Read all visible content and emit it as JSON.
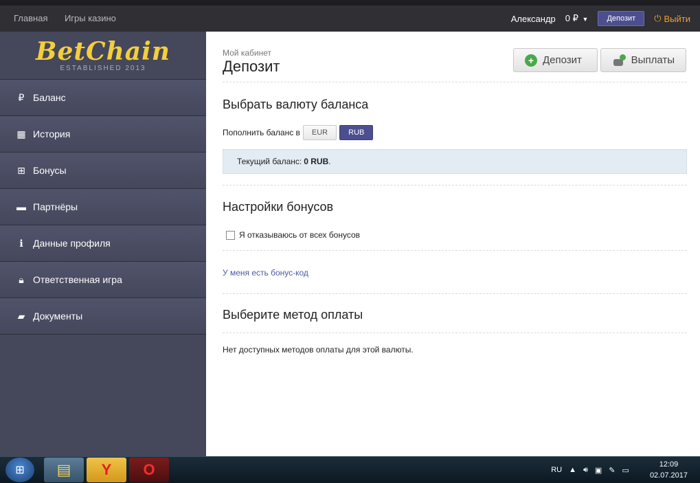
{
  "topnav": {
    "links": [
      "Главная",
      "Игры казино"
    ],
    "user": "Александр",
    "balance": "0 ₽",
    "deposit_button": "Депозит",
    "logout": "Выйти"
  },
  "logo": {
    "brand": "BetChain",
    "established": "ESTABLISHED 2013"
  },
  "sidebar": {
    "items": [
      {
        "label": "Баланс",
        "icon": "ruble-icon"
      },
      {
        "label": "История",
        "icon": "calendar-icon"
      },
      {
        "label": "Бонусы",
        "icon": "gift-icon"
      },
      {
        "label": "Партнёры",
        "icon": "briefcase-icon"
      },
      {
        "label": "Данные профиля",
        "icon": "info-icon"
      },
      {
        "label": "Ответственная игра",
        "icon": "lock-icon"
      },
      {
        "label": "Документы",
        "icon": "folder-icon"
      }
    ]
  },
  "page": {
    "breadcrumb": "Мой кабинет",
    "title": "Депозит",
    "deposit_button": "Депозит",
    "payout_button": "Выплаты"
  },
  "currency": {
    "title": "Выбрать валюту баланса",
    "label": "Пополнить баланс в",
    "options": [
      "EUR",
      "RUB"
    ],
    "selected": "RUB",
    "balance_prefix": "Текущий баланс: ",
    "balance_value": "0 RUB",
    "balance_suffix": "."
  },
  "bonus": {
    "title": "Настройки бонусов",
    "refuse_label": "Я отказываюсь от всех бонусов",
    "refuse_checked": false,
    "code_link": "У меня есть бонус-код"
  },
  "payment": {
    "title": "Выберите метод оплаты",
    "empty": "Нет доступных методов оплаты для этой валюты."
  },
  "taskbar": {
    "lang": "RU",
    "time": "12:09",
    "date": "02.07.2017"
  }
}
